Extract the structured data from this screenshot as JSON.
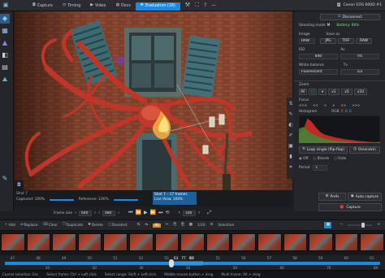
{
  "app": {
    "camera_model": "Canon EOS 600D #1",
    "tabs": [
      {
        "label": "Capture",
        "icon": "camera-icon"
      },
      {
        "label": "Timing",
        "icon": "clock-icon"
      },
      {
        "label": "Video",
        "icon": "video-icon"
      },
      {
        "label": "Docs",
        "icon": "document-icon"
      },
      {
        "label": "Evaluation (16)",
        "icon": "gear-icon"
      }
    ]
  },
  "panel": {
    "disconnect_label": "Disconnect",
    "shooting_mode_label": "Shooting mode",
    "shooting_mode_value": "M",
    "battery_label": "Battery: 86%",
    "image_label": "Image",
    "save_as_label": "Save as",
    "image_formats": [
      "RAW",
      "JPG",
      "TIFF",
      "RAW"
    ],
    "iso_label": "ISO",
    "aperture_label": "Av",
    "iso_value": "800",
    "aperture_value": "f/4",
    "white_balance_label": "White balance",
    "tv_label": "Tv",
    "white_balance_value": "Fluorescent",
    "tv_value": "1/2",
    "zoom_label": "Zoom",
    "zoom_buttons": [
      "AF",
      "",
      "x1",
      "x5",
      "x10"
    ],
    "focus_label": "Focus",
    "focus_steps": [
      "<<<",
      "<<",
      "<",
      ">",
      ">>",
      ">>>"
    ],
    "histogram_label": "Histogram",
    "histogram_modes": [
      "RGB",
      "R",
      "G",
      "B"
    ],
    "histogram_r": [
      0.35,
      0.5,
      0.95,
      0.82,
      0.6,
      0.42,
      0.33,
      0.28,
      0.24,
      0.2,
      0.17,
      0.14,
      0.12,
      0.1,
      0.08,
      0.07,
      0.05,
      0.04,
      0.03,
      0.05
    ],
    "histogram_g": [
      0.55,
      0.62,
      0.48,
      0.36,
      0.29,
      0.22,
      0.17,
      0.13,
      0.1,
      0.08,
      0.06,
      0.05,
      0.04,
      0.03,
      0.02,
      0.02,
      0.01,
      0.01,
      0.01,
      0.02
    ],
    "loop_label": "Loop single (flip-flop)",
    "onionskin_label": "Onionskin",
    "onion_options": [
      "Off",
      "Blends",
      "Fade"
    ],
    "period_label": "Period",
    "period_value": "1",
    "prefs_label": "Prefs",
    "auto_capture_label": "Auto capture",
    "capture_label": "Capture"
  },
  "info": {
    "shot_name": "Shot 7",
    "captured_label": "Captured: 100%",
    "reference_label": "Reference: 100%",
    "shot_name2": "Shot 7 – 17 frames",
    "live_view_label": "Live View: 100%"
  },
  "controls": {
    "frame_size_label": "Frame size",
    "frame_size_w": "640",
    "frame_size_h": "480",
    "zoom_value": "100"
  },
  "cmdbar": {
    "items": [
      "Add",
      "Replace",
      "Clear",
      "Duplicate",
      "Delete",
      "Deselect",
      "1/16",
      "Selection"
    ],
    "fps": "10",
    "frame_badge": "80",
    "timeline_counter": "80"
  },
  "timeline": {
    "frame_numbers": [
      "47",
      "48",
      "49",
      "50",
      "51",
      "52",
      "53",
      "54",
      "55",
      "56",
      "57",
      "58",
      "59",
      "60",
      "61"
    ],
    "markers": [
      "10",
      "20",
      "30",
      "40",
      "50",
      "60",
      "70",
      "80"
    ],
    "playhead_labels": [
      "63",
      "77",
      "80"
    ],
    "current_value": "80"
  },
  "status": {
    "items": [
      "Cancel selection: Esc",
      "Select frame: Ctrl + Left click",
      "Select range: Shift + Left click",
      "Middle mouse button + drag",
      "Multi frame: Alt + drag"
    ]
  },
  "colors": {
    "accent": "#1c8ae0",
    "capture_red": "#e13a2f",
    "selection_green": "#35d04a",
    "panel_bg": "#24262a",
    "histogram_red": "#d9302a",
    "histogram_green": "#3c8a3a"
  }
}
